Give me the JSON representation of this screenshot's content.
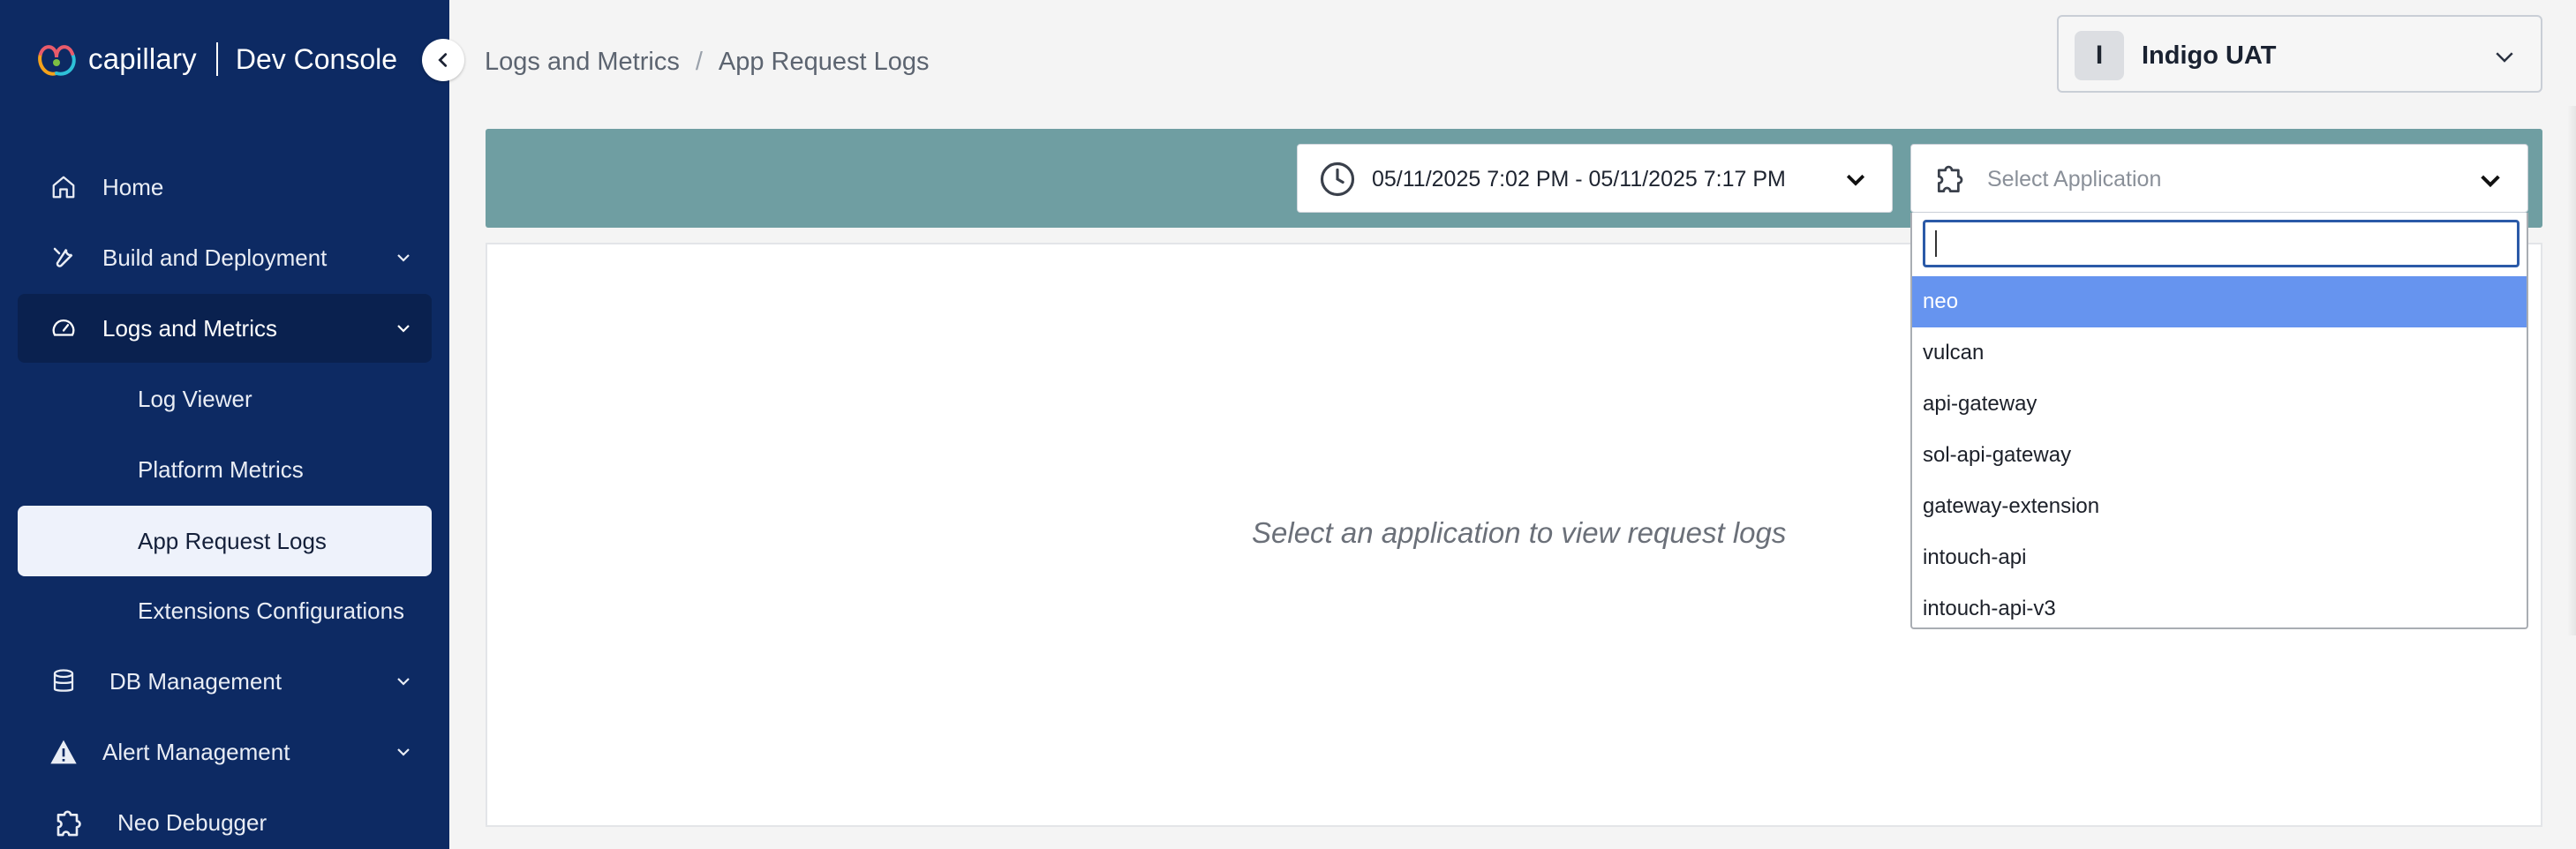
{
  "brand": {
    "name": "capillary",
    "product": "Dev Console"
  },
  "sidebar": {
    "items": [
      {
        "label": "Home",
        "icon": "home-icon"
      },
      {
        "label": "Build and Deployment",
        "icon": "wrench-icon"
      },
      {
        "label": "Logs and Metrics",
        "icon": "gauge-icon"
      },
      {
        "label": "Log Viewer"
      },
      {
        "label": "Platform Metrics"
      },
      {
        "label": "App Request Logs"
      },
      {
        "label": "Extensions Configurations"
      },
      {
        "label": "DB Management",
        "icon": "database-icon"
      },
      {
        "label": "Alert Management",
        "icon": "warning-icon"
      },
      {
        "label": "Neo Debugger",
        "icon": "puzzle-icon"
      }
    ]
  },
  "breadcrumb": {
    "parent": "Logs and Metrics",
    "separator": "/",
    "current": "App Request Logs"
  },
  "org": {
    "initial": "I",
    "name": "Indigo UAT"
  },
  "filters": {
    "date_range": "05/11/2025 7:02 PM - 05/11/2025 7:17 PM",
    "app_placeholder": "Select Application",
    "search_value": ""
  },
  "dropdown": {
    "options": [
      "neo",
      "vulcan",
      "api-gateway",
      "sol-api-gateway",
      "gateway-extension",
      "intouch-api",
      "intouch-api-v3"
    ],
    "highlighted": "neo"
  },
  "empty_state": "Select an application to view request logs",
  "colors": {
    "sidebar": "#0d2a63",
    "filter_bar": "#6f9ea2",
    "highlight": "#6694ef"
  }
}
